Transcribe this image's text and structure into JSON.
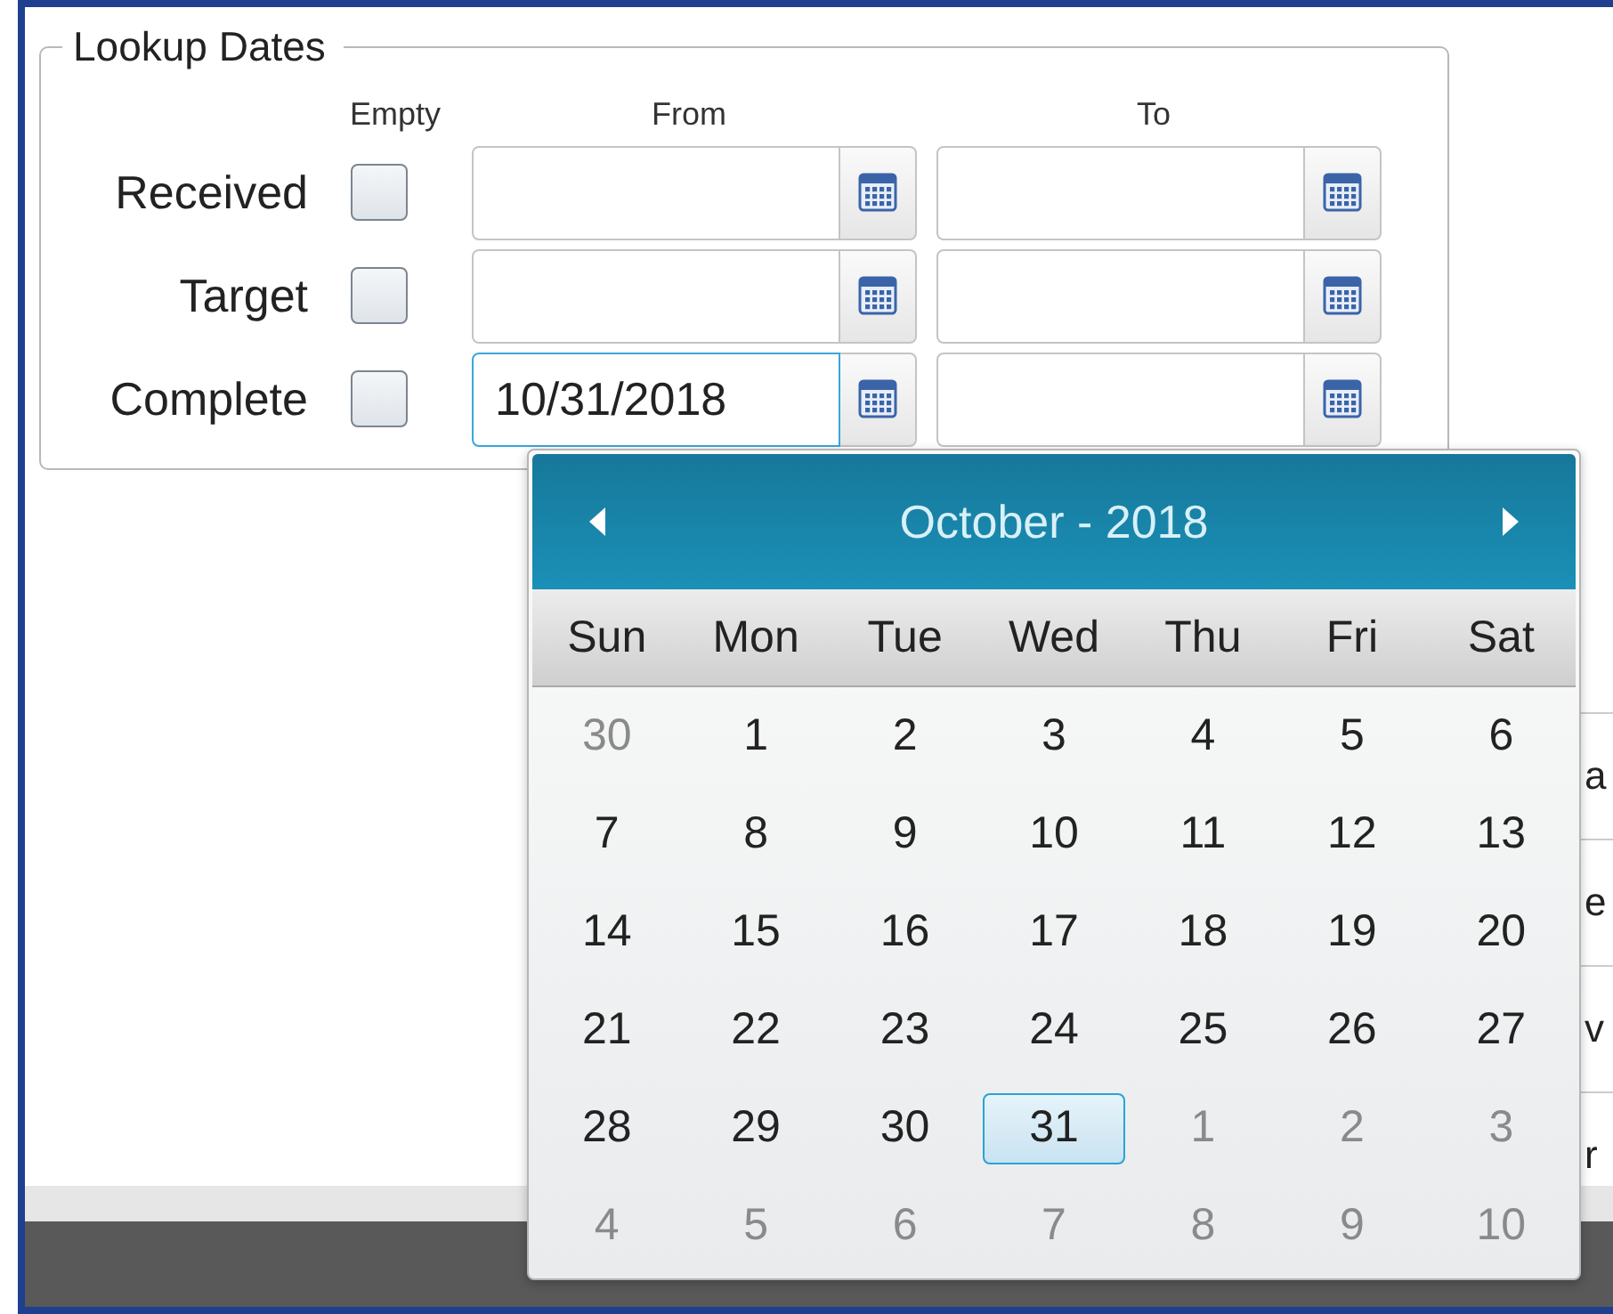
{
  "lookup_dates": {
    "legend": "Lookup Dates",
    "columns": [
      "Empty",
      "From",
      "To"
    ],
    "rows": [
      {
        "label": "Received",
        "empty_checked": false,
        "from": {
          "focused": false
        },
        "to": {
          "focused": false
        }
      },
      {
        "label": "Target",
        "empty_checked": false,
        "from": {
          "focused": false
        },
        "to": {
          "focused": false
        }
      },
      {
        "label": "Complete",
        "empty_checked": false,
        "from": {
          "value": "10/31/2018",
          "focused": true
        },
        "to": {
          "focused": false
        }
      }
    ]
  },
  "background_table": {
    "rows": [
      "a",
      "e",
      "v",
      "r"
    ]
  },
  "calendar": {
    "title": "October - 2018",
    "day_names": [
      "Sun",
      "Mon",
      "Tue",
      "Wed",
      "Thu",
      "Fri",
      "Sat"
    ],
    "weeks": [
      [
        {
          "label": "30",
          "in_month": false,
          "selected": false
        },
        {
          "label": "1",
          "in_month": true,
          "selected": false
        },
        {
          "label": "2",
          "in_month": true,
          "selected": false
        },
        {
          "label": "3",
          "in_month": true,
          "selected": false
        },
        {
          "label": "4",
          "in_month": true,
          "selected": false
        },
        {
          "label": "5",
          "in_month": true,
          "selected": false
        },
        {
          "label": "6",
          "in_month": true,
          "selected": false
        }
      ],
      [
        {
          "label": "7",
          "in_month": true,
          "selected": false
        },
        {
          "label": "8",
          "in_month": true,
          "selected": false
        },
        {
          "label": "9",
          "in_month": true,
          "selected": false
        },
        {
          "label": "10",
          "in_month": true,
          "selected": false
        },
        {
          "label": "11",
          "in_month": true,
          "selected": false
        },
        {
          "label": "12",
          "in_month": true,
          "selected": false
        },
        {
          "label": "13",
          "in_month": true,
          "selected": false
        }
      ],
      [
        {
          "label": "14",
          "in_month": true,
          "selected": false
        },
        {
          "label": "15",
          "in_month": true,
          "selected": false
        },
        {
          "label": "16",
          "in_month": true,
          "selected": false
        },
        {
          "label": "17",
          "in_month": true,
          "selected": false
        },
        {
          "label": "18",
          "in_month": true,
          "selected": false
        },
        {
          "label": "19",
          "in_month": true,
          "selected": false
        },
        {
          "label": "20",
          "in_month": true,
          "selected": false
        }
      ],
      [
        {
          "label": "21",
          "in_month": true,
          "selected": false
        },
        {
          "label": "22",
          "in_month": true,
          "selected": false
        },
        {
          "label": "23",
          "in_month": true,
          "selected": false
        },
        {
          "label": "24",
          "in_month": true,
          "selected": false
        },
        {
          "label": "25",
          "in_month": true,
          "selected": false
        },
        {
          "label": "26",
          "in_month": true,
          "selected": false
        },
        {
          "label": "27",
          "in_month": true,
          "selected": false
        }
      ],
      [
        {
          "label": "28",
          "in_month": true,
          "selected": false
        },
        {
          "label": "29",
          "in_month": true,
          "selected": false
        },
        {
          "label": "30",
          "in_month": true,
          "selected": false
        },
        {
          "label": "31",
          "in_month": true,
          "selected": true
        },
        {
          "label": "1",
          "in_month": false,
          "selected": false
        },
        {
          "label": "2",
          "in_month": false,
          "selected": false
        },
        {
          "label": "3",
          "in_month": false,
          "selected": false
        }
      ],
      [
        {
          "label": "4",
          "in_month": false,
          "selected": false
        },
        {
          "label": "5",
          "in_month": false,
          "selected": false
        },
        {
          "label": "6",
          "in_month": false,
          "selected": false
        },
        {
          "label": "7",
          "in_month": false,
          "selected": false
        },
        {
          "label": "8",
          "in_month": false,
          "selected": false
        },
        {
          "label": "9",
          "in_month": false,
          "selected": false
        },
        {
          "label": "10",
          "in_month": false,
          "selected": false
        }
      ]
    ]
  }
}
